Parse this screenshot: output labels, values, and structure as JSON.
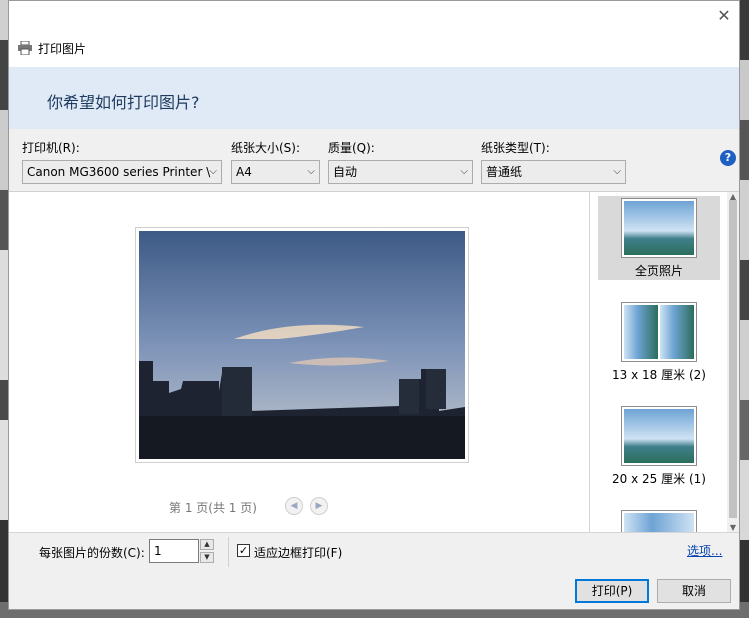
{
  "window": {
    "title": "打印图片",
    "heading": "你希望如何打印图片?",
    "close_icon": "close-icon",
    "help_icon": "help-icon"
  },
  "settings": {
    "printer": {
      "label": "打印机(R):",
      "value": "Canon MG3600 series Printer \\"
    },
    "paper_size": {
      "label": "纸张大小(S):",
      "value": "A4"
    },
    "quality": {
      "label": "质量(Q):",
      "value": "自动"
    },
    "paper_type": {
      "label": "纸张类型(T):",
      "value": "普通纸"
    }
  },
  "preview": {
    "pager": "第 1 页(共 1 页)",
    "prev_icon": "chevron-left-icon",
    "next_icon": "chevron-right-icon"
  },
  "layouts": [
    {
      "label": "全页照片",
      "selected": true
    },
    {
      "label": "13 x 18 厘米 (2)",
      "selected": false
    },
    {
      "label": "20 x 25 厘米 (1)",
      "selected": false
    }
  ],
  "copies": {
    "label": "每张图片的份数(C):",
    "value": "1"
  },
  "fit_frame": {
    "label": "适应边框打印(F)",
    "checked": true
  },
  "options_link": "选项...",
  "buttons": {
    "print": "打印(P)",
    "cancel": "取消"
  },
  "colors": {
    "header_band": "#dfeaf6",
    "accent": "#0078d7",
    "link": "#0645ad"
  }
}
